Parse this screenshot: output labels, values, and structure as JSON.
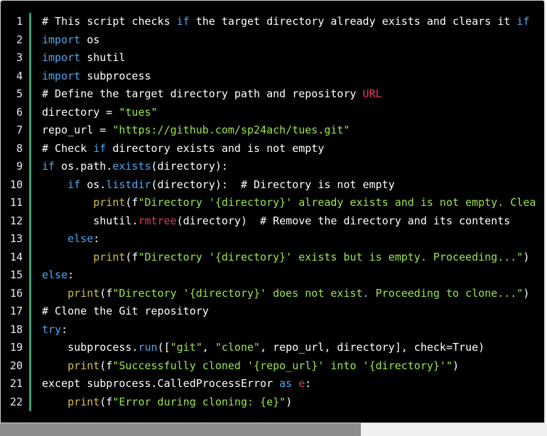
{
  "editor": {
    "lines": [
      {
        "n": "1",
        "tokens": [
          {
            "t": "# This script checks ",
            "c": "plain"
          },
          {
            "t": "if",
            "c": "kw"
          },
          {
            "t": " the target directory already exists and clears it ",
            "c": "plain"
          },
          {
            "t": "if",
            "c": "kw"
          }
        ]
      },
      {
        "n": "2",
        "tokens": [
          {
            "t": "import",
            "c": "kw"
          },
          {
            "t": " os",
            "c": "plain"
          }
        ]
      },
      {
        "n": "3",
        "tokens": [
          {
            "t": "import",
            "c": "kw"
          },
          {
            "t": " shutil",
            "c": "plain"
          }
        ]
      },
      {
        "n": "4",
        "tokens": [
          {
            "t": "import",
            "c": "kw"
          },
          {
            "t": " subprocess",
            "c": "plain"
          }
        ]
      },
      {
        "n": "5",
        "tokens": [
          {
            "t": "# Define the target directory path and repository ",
            "c": "plain"
          },
          {
            "t": "URL",
            "c": "red"
          }
        ]
      },
      {
        "n": "6",
        "tokens": [
          {
            "t": "directory = ",
            "c": "plain"
          },
          {
            "t": "\"tues\"",
            "c": "str"
          }
        ]
      },
      {
        "n": "7",
        "tokens": [
          {
            "t": "repo_url = ",
            "c": "plain"
          },
          {
            "t": "\"https://github.com/sp24ach/tues.git\"",
            "c": "str"
          }
        ]
      },
      {
        "n": "8",
        "tokens": [
          {
            "t": "# Check ",
            "c": "plain"
          },
          {
            "t": "if",
            "c": "kw"
          },
          {
            "t": " directory exists and is not empty",
            "c": "plain"
          }
        ]
      },
      {
        "n": "9",
        "tokens": [
          {
            "t": "if",
            "c": "kw"
          },
          {
            "t": " os.path.",
            "c": "plain"
          },
          {
            "t": "exists",
            "c": "kw"
          },
          {
            "t": "(directory):",
            "c": "plain"
          }
        ]
      },
      {
        "n": "10",
        "tokens": [
          {
            "t": "    ",
            "c": "plain"
          },
          {
            "t": "if",
            "c": "kw"
          },
          {
            "t": " os.",
            "c": "plain"
          },
          {
            "t": "listdir",
            "c": "kw"
          },
          {
            "t": "(directory):  # Directory is not empty",
            "c": "plain"
          }
        ]
      },
      {
        "n": "11",
        "tokens": [
          {
            "t": "        ",
            "c": "plain"
          },
          {
            "t": "print",
            "c": "fn"
          },
          {
            "t": "(f",
            "c": "plain"
          },
          {
            "t": "\"Directory '{directory}' already exists and is not empty. Clea",
            "c": "str"
          }
        ]
      },
      {
        "n": "12",
        "tokens": [
          {
            "t": "        shutil.",
            "c": "plain"
          },
          {
            "t": "rmtree",
            "c": "red"
          },
          {
            "t": "(directory)  # Remove the directory and its contents",
            "c": "plain"
          }
        ]
      },
      {
        "n": "13",
        "tokens": [
          {
            "t": "    ",
            "c": "plain"
          },
          {
            "t": "else",
            "c": "kw"
          },
          {
            "t": ":",
            "c": "plain"
          }
        ]
      },
      {
        "n": "14",
        "tokens": [
          {
            "t": "        ",
            "c": "plain"
          },
          {
            "t": "print",
            "c": "fn"
          },
          {
            "t": "(f",
            "c": "plain"
          },
          {
            "t": "\"Directory '{directory}' exists but is empty. Proceeding...\"",
            "c": "str"
          },
          {
            "t": ")",
            "c": "plain"
          }
        ]
      },
      {
        "n": "15",
        "tokens": [
          {
            "t": "else",
            "c": "kw"
          },
          {
            "t": ":",
            "c": "plain"
          }
        ]
      },
      {
        "n": "16",
        "tokens": [
          {
            "t": "    ",
            "c": "plain"
          },
          {
            "t": "print",
            "c": "fn"
          },
          {
            "t": "(f",
            "c": "plain"
          },
          {
            "t": "\"Directory '{directory}' does not exist. Proceeding to clone...\"",
            "c": "str"
          },
          {
            "t": ")",
            "c": "plain"
          }
        ]
      },
      {
        "n": "17",
        "tokens": [
          {
            "t": "# Clone the Git repository",
            "c": "plain"
          }
        ]
      },
      {
        "n": "18",
        "tokens": [
          {
            "t": "try",
            "c": "kw"
          },
          {
            "t": ":",
            "c": "plain"
          }
        ]
      },
      {
        "n": "19",
        "tokens": [
          {
            "t": "    subprocess.",
            "c": "plain"
          },
          {
            "t": "run",
            "c": "kw"
          },
          {
            "t": "([",
            "c": "plain"
          },
          {
            "t": "\"git\"",
            "c": "str"
          },
          {
            "t": ", ",
            "c": "plain"
          },
          {
            "t": "\"clone\"",
            "c": "str"
          },
          {
            "t": ", repo_url, directory], check=True)",
            "c": "plain"
          }
        ]
      },
      {
        "n": "20",
        "tokens": [
          {
            "t": "    ",
            "c": "plain"
          },
          {
            "t": "print",
            "c": "fn"
          },
          {
            "t": "(f",
            "c": "plain"
          },
          {
            "t": "\"Successfully cloned '{repo_url}' into '{directory}'\"",
            "c": "str"
          },
          {
            "t": ")",
            "c": "plain"
          }
        ]
      },
      {
        "n": "21",
        "tokens": [
          {
            "t": "except subprocess.CalledProcessError ",
            "c": "plain"
          },
          {
            "t": "as",
            "c": "kw"
          },
          {
            "t": " ",
            "c": "plain"
          },
          {
            "t": "e",
            "c": "red"
          },
          {
            "t": ":",
            "c": "plain"
          }
        ]
      },
      {
        "n": "22",
        "tokens": [
          {
            "t": "    ",
            "c": "plain"
          },
          {
            "t": "print",
            "c": "fn"
          },
          {
            "t": "(f",
            "c": "plain"
          },
          {
            "t": "\"Error during cloning: {e}\"",
            "c": "str"
          },
          {
            "t": ")",
            "c": "plain"
          }
        ]
      }
    ]
  },
  "colors": {
    "background": "#000000",
    "keyword": "#4ea7ef",
    "function": "#d0c240",
    "string": "#9ae64c",
    "highlight": "#e8375a",
    "gutter_rule": "#3ea06a"
  },
  "scrollbar": {
    "position_fraction": 0.0,
    "visible_fraction": 0.66
  }
}
